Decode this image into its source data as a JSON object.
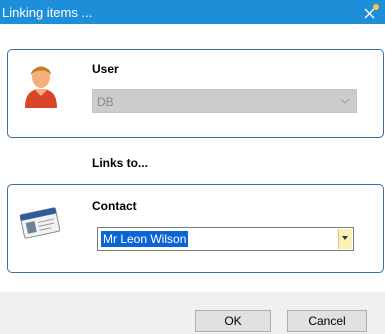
{
  "window": {
    "title": "Linking items ..."
  },
  "user_group": {
    "label": "User",
    "icon": "user-icon",
    "selected_value": "DB"
  },
  "links_to_label": "Links to...",
  "contact_group": {
    "label": "Contact",
    "icon": "contact-card-icon",
    "selected_value": "Mr Leon Wilson"
  },
  "buttons": {
    "ok_label": "OK",
    "cancel_label": "Cancel"
  },
  "colors": {
    "titlebar": "#1c8fd8",
    "group_border": "#3a6ea5",
    "selection": "#0a64d6",
    "dropdown_button": "#fbf0b5"
  }
}
